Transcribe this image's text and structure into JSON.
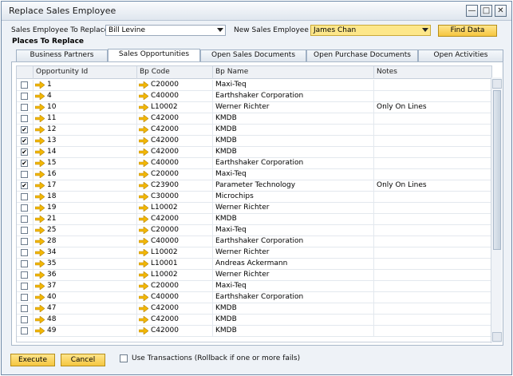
{
  "window": {
    "title": "Replace Sales Employee",
    "controls": {
      "minimize": "—",
      "maximize": "□",
      "close": "✕"
    }
  },
  "form": {
    "employee_to_replace_label": "Sales Employee To Replace",
    "employee_to_replace_value": "Bill Levine",
    "new_employee_label": "New Sales Employee",
    "new_employee_value": "James Chan",
    "find_button": "Find Data",
    "places_label": "Places To Replace"
  },
  "tabs": [
    {
      "label": "Business Partners"
    },
    {
      "label": "Sales Opportunities"
    },
    {
      "label": "Open Sales Documents"
    },
    {
      "label": "Open Purchase Documents"
    },
    {
      "label": "Open Activities"
    }
  ],
  "grid": {
    "columns": [
      "Opportunity Id",
      "Bp Code",
      "Bp Name",
      "Notes"
    ],
    "rows": [
      {
        "checked": false,
        "id": "1",
        "code": "C20000",
        "name": "Maxi-Teq",
        "notes": ""
      },
      {
        "checked": false,
        "id": "4",
        "code": "C40000",
        "name": "Earthshaker Corporation",
        "notes": ""
      },
      {
        "checked": false,
        "id": "10",
        "code": "L10002",
        "name": "Werner Richter",
        "notes": "Only On Lines"
      },
      {
        "checked": false,
        "id": "11",
        "code": "C42000",
        "name": "KMDB",
        "notes": ""
      },
      {
        "checked": true,
        "id": "12",
        "code": "C42000",
        "name": "KMDB",
        "notes": ""
      },
      {
        "checked": true,
        "id": "13",
        "code": "C42000",
        "name": "KMDB",
        "notes": ""
      },
      {
        "checked": true,
        "id": "14",
        "code": "C42000",
        "name": "KMDB",
        "notes": ""
      },
      {
        "checked": true,
        "id": "15",
        "code": "C40000",
        "name": "Earthshaker Corporation",
        "notes": ""
      },
      {
        "checked": false,
        "id": "16",
        "code": "C20000",
        "name": "Maxi-Teq",
        "notes": ""
      },
      {
        "checked": true,
        "id": "17",
        "code": "C23900",
        "name": "Parameter Technology",
        "notes": "Only On Lines"
      },
      {
        "checked": false,
        "id": "18",
        "code": "C30000",
        "name": "Microchips",
        "notes": ""
      },
      {
        "checked": false,
        "id": "19",
        "code": "L10002",
        "name": "Werner Richter",
        "notes": ""
      },
      {
        "checked": false,
        "id": "21",
        "code": "C42000",
        "name": "KMDB",
        "notes": ""
      },
      {
        "checked": false,
        "id": "25",
        "code": "C20000",
        "name": "Maxi-Teq",
        "notes": ""
      },
      {
        "checked": false,
        "id": "28",
        "code": "C40000",
        "name": "Earthshaker Corporation",
        "notes": ""
      },
      {
        "checked": false,
        "id": "34",
        "code": "L10002",
        "name": "Werner Richter",
        "notes": ""
      },
      {
        "checked": false,
        "id": "35",
        "code": "L10001",
        "name": "Andreas Ackermann",
        "notes": ""
      },
      {
        "checked": false,
        "id": "36",
        "code": "L10002",
        "name": "Werner Richter",
        "notes": ""
      },
      {
        "checked": false,
        "id": "37",
        "code": "C20000",
        "name": "Maxi-Teq",
        "notes": ""
      },
      {
        "checked": false,
        "id": "40",
        "code": "C40000",
        "name": "Earthshaker Corporation",
        "notes": ""
      },
      {
        "checked": false,
        "id": "47",
        "code": "C42000",
        "name": "KMDB",
        "notes": ""
      },
      {
        "checked": false,
        "id": "48",
        "code": "C42000",
        "name": "KMDB",
        "notes": ""
      },
      {
        "checked": false,
        "id": "49",
        "code": "C42000",
        "name": "KMDB",
        "notes": ""
      }
    ]
  },
  "footer": {
    "execute_button": "Execute",
    "cancel_button": "Cancel",
    "transactions_label": "Use Transactions (Rollback if one or more fails)"
  },
  "colors": {
    "accent_yellow": "#f5c640",
    "link_arrow": "#f2b705"
  }
}
